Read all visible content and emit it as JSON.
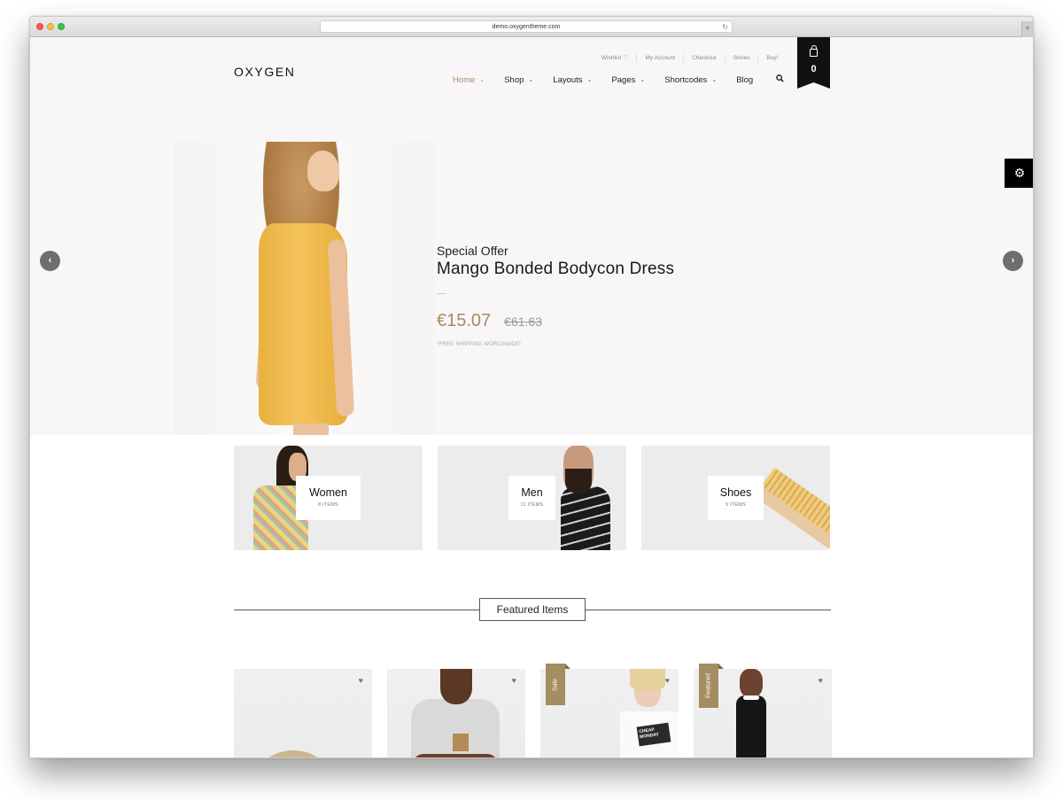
{
  "browser": {
    "url": "demo.oxygentheme.com",
    "reload_icon": "↻",
    "newtab_icon": "+"
  },
  "header": {
    "logo": "OXYGEN",
    "topbar": [
      {
        "label": "Wishlist",
        "icon": "♡"
      },
      {
        "label": "My Account"
      },
      {
        "label": "Checkout"
      },
      {
        "label": "Stores"
      },
      {
        "label": "Buy!"
      }
    ],
    "nav": [
      {
        "label": "Home",
        "active": true,
        "dropdown": true
      },
      {
        "label": "Shop",
        "dropdown": true
      },
      {
        "label": "Layouts",
        "dropdown": true
      },
      {
        "label": "Pages",
        "dropdown": true
      },
      {
        "label": "Shortcodes",
        "dropdown": true
      },
      {
        "label": "Blog",
        "dropdown": false
      }
    ],
    "chevron": "⌄",
    "search_icon": "🔍",
    "cart_count": "0"
  },
  "hero": {
    "kicker": "Special Offer",
    "title": "Mango Bonded Bodycon Dress",
    "price": "€15.07",
    "old_price": "€61.63",
    "shipping_note": "*FREE SHIPPING WORLDWIDE!",
    "prev_icon": "‹",
    "next_icon": "›"
  },
  "settings_icon": "⚙",
  "categories": [
    {
      "name": "Women",
      "count": "8 ITEMS"
    },
    {
      "name": "Men",
      "count": "11 ITEMS"
    },
    {
      "name": "Shoes",
      "count": "5 ITEMS"
    }
  ],
  "featured": {
    "title": "Featured Items",
    "heart_icon": "♥",
    "products": [
      {
        "badge": null
      },
      {
        "badge": null
      },
      {
        "badge": "Sale",
        "print": "CHEAP MONDAY"
      },
      {
        "badge": "Featured"
      }
    ]
  },
  "colors": {
    "accent": "#a58d62",
    "header_bg": "#f8f6f7",
    "cart_bg": "#111111"
  }
}
